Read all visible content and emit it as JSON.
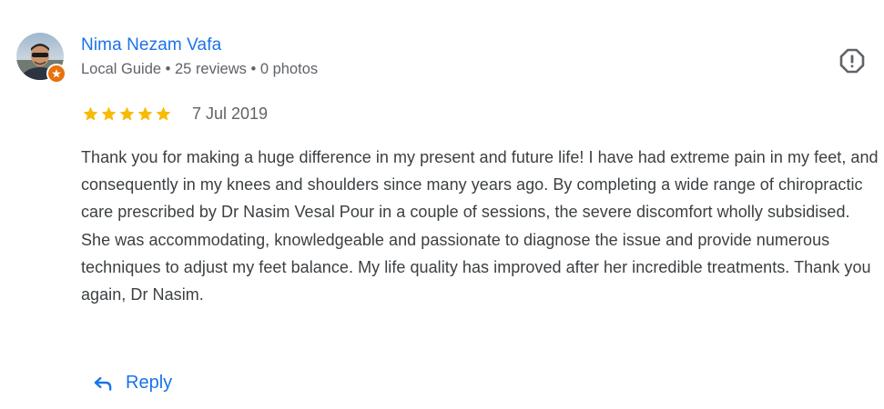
{
  "review": {
    "author_name": "Nima Nezam Vafa",
    "author_meta": "Local Guide • 25 reviews • 0 photos",
    "rating": 5,
    "rating_max": 5,
    "date": "7 Jul 2019",
    "text": "Thank you for making a huge difference in my present and future life! I have had extreme pain in my feet, and consequently in my knees and shoulders since many years ago. By completing a wide range of chiropractic care prescribed by Dr Nasim Vesal Pour in a couple of sessions, the severe discomfort wholly subsidised. She was accommodating, knowledgeable and passionate to diagnose the issue and provide numerous techniques to adjust my feet balance. My life quality has improved after her incredible treatments. Thank you again, Dr Nasim."
  },
  "actions": {
    "reply_label": "Reply"
  },
  "icons": {
    "avatar": "avatar",
    "badge": "local-guide-badge-icon",
    "report": "report-icon",
    "star": "star-icon",
    "reply": "reply-arrow-icon"
  },
  "colors": {
    "link_blue": "#1a73e8",
    "star_gold": "#f6bb06",
    "badge_orange": "#e8710a",
    "meta_gray": "#5f6368",
    "text_dark": "#3c4043"
  }
}
